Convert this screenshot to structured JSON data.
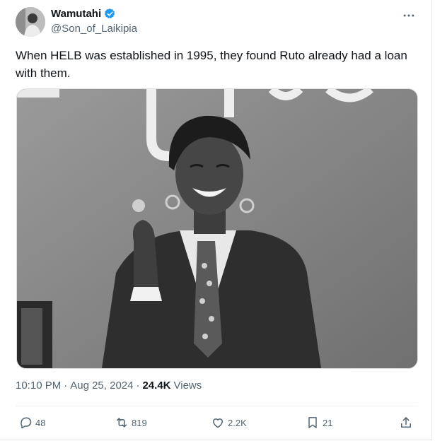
{
  "author": {
    "name": "Wamutahi",
    "handle": "@Son_of_Laikipia",
    "verified": true
  },
  "more_icon": "more-horizontal-icon",
  "tweet": {
    "text": "When HELB was established in 1995, they found Ruto already had a loan with them."
  },
  "meta": {
    "time": "10:10 PM",
    "separator1": "·",
    "date": "Aug 25, 2024",
    "separator2": "·",
    "views_count": "24.4K",
    "views_label": "Views"
  },
  "actions": {
    "replies": "48",
    "retweets": "819",
    "likes": "2.2K",
    "bookmarks": "21"
  },
  "colors": {
    "verified_badge": "#1d9bf0",
    "secondary_text": "#536471",
    "primary_text": "#0f1419"
  }
}
